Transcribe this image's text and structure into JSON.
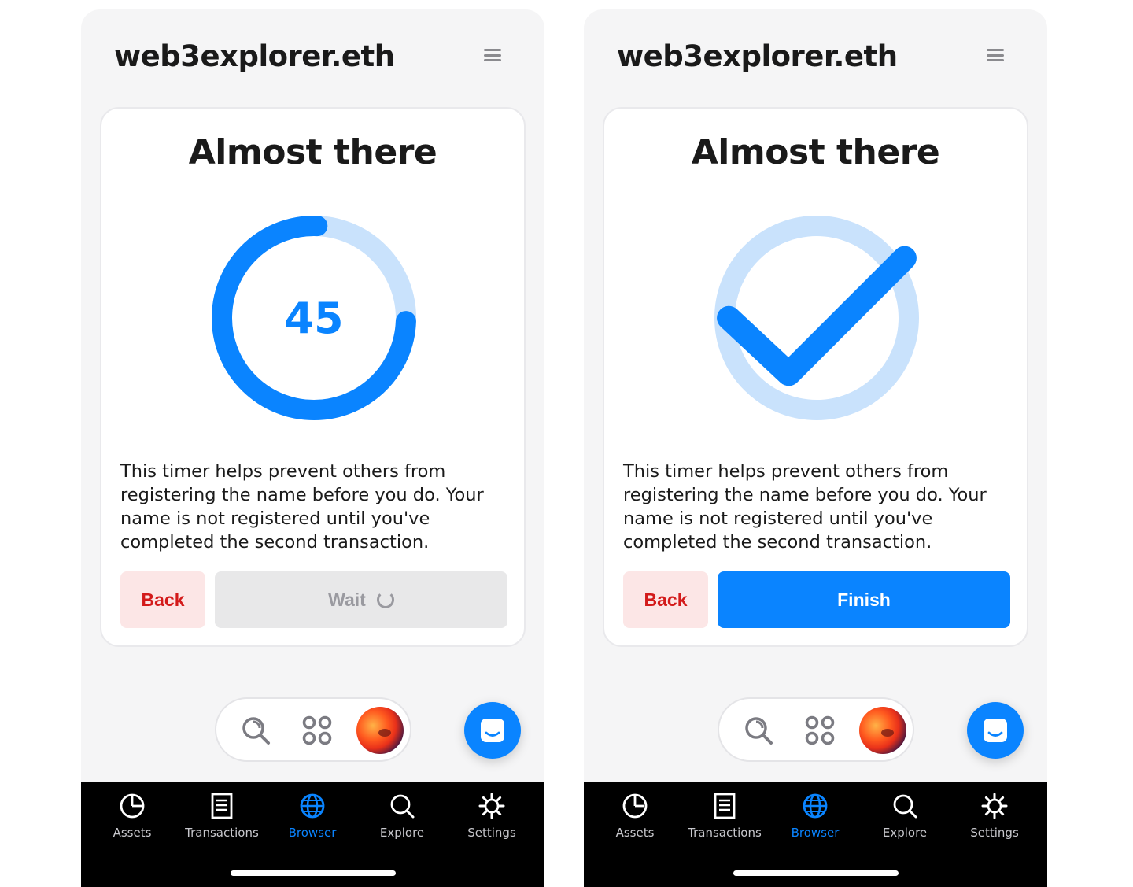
{
  "screens": [
    {
      "site_title": "web3explorer.eth",
      "card_title": "Almost there",
      "timer_value": "45",
      "timer_progress_remaining": 0.75,
      "description": "This timer helps prevent others from registering the name before you do. Your name is not registered until you've completed the second transaction.",
      "back_label": "Back",
      "primary_label": "Wait",
      "primary_state": "disabled"
    },
    {
      "site_title": "web3explorer.eth",
      "card_title": "Almost there",
      "timer_value": "",
      "timer_progress_remaining": 0,
      "description": "This timer helps prevent others from registering the name before you do. Your name is not registered until you've completed the second transaction.",
      "back_label": "Back",
      "primary_label": "Finish",
      "primary_state": "enabled"
    }
  ],
  "tabbar": {
    "items": [
      {
        "label": "Assets",
        "icon": "pie-chart-icon"
      },
      {
        "label": "Transactions",
        "icon": "document-icon"
      },
      {
        "label": "Browser",
        "icon": "globe-icon",
        "active": true
      },
      {
        "label": "Explore",
        "icon": "search-icon"
      },
      {
        "label": "Settings",
        "icon": "gear-icon"
      }
    ]
  },
  "colors": {
    "accent": "#0a84ff",
    "ring_track": "#c9e2fc",
    "back_bg": "#fce6e6",
    "back_text": "#d31b1b",
    "disabled_bg": "#e8e8e9",
    "tabbar_bg": "#000000"
  }
}
